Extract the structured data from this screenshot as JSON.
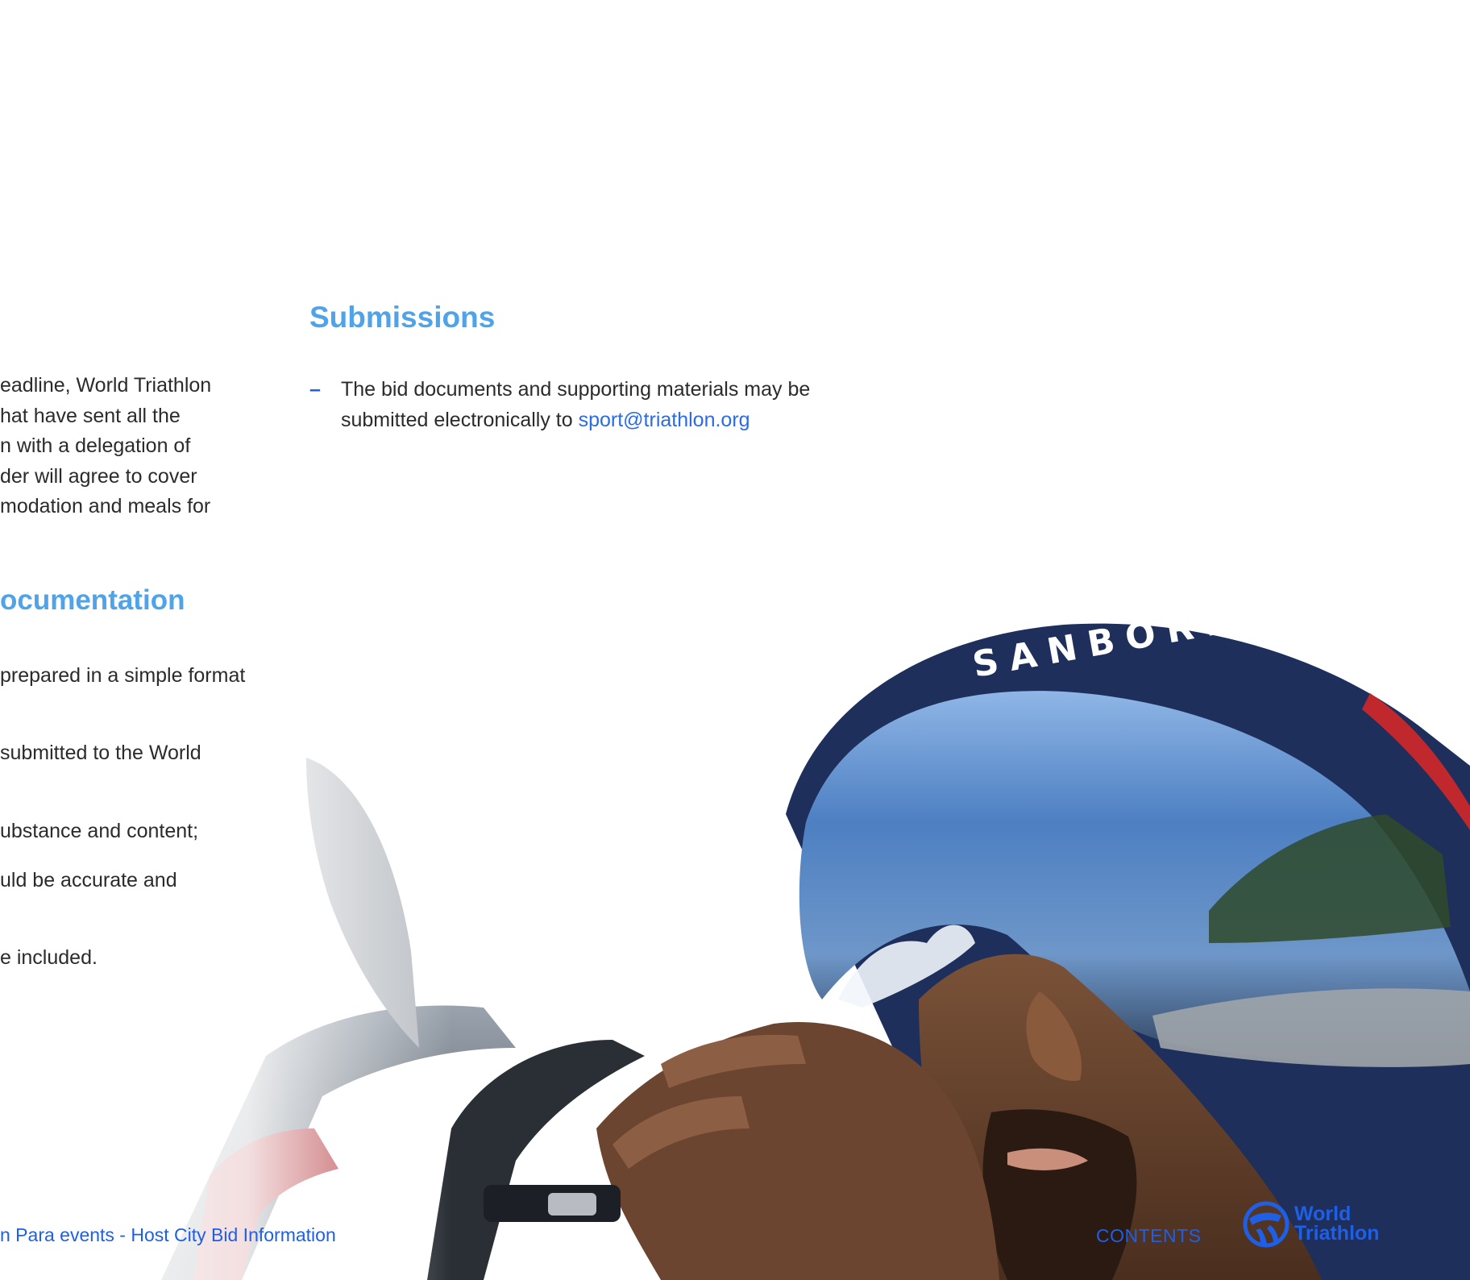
{
  "left_column": {
    "intro_lines": [
      "eadline, World Triathlon",
      "hat have sent all the",
      "n with a delegation of",
      "der will agree to cover",
      "modation and meals for"
    ],
    "heading": "ocumentation",
    "list_lines": [
      "prepared in a simple format",
      "submitted to the World",
      "ubstance and content;",
      "uld be accurate and",
      "e included."
    ]
  },
  "submissions": {
    "heading": "Submissions",
    "bullet": "–",
    "text_before_link": "The bid documents and supporting materials may be submitted electronically to ",
    "email": "sport@triathlon.org"
  },
  "footer": {
    "title": "n Para events - Host City Bid Information",
    "contents_link": "CONTENTS",
    "logo_line1": "World",
    "logo_line2": "Triathlon"
  },
  "photo": {
    "helmet_lettering": "SANBORN"
  },
  "colors": {
    "heading_blue": "#4fa3e8",
    "accent_blue": "#1f5fe6",
    "body_text": "#2b2b2b"
  }
}
